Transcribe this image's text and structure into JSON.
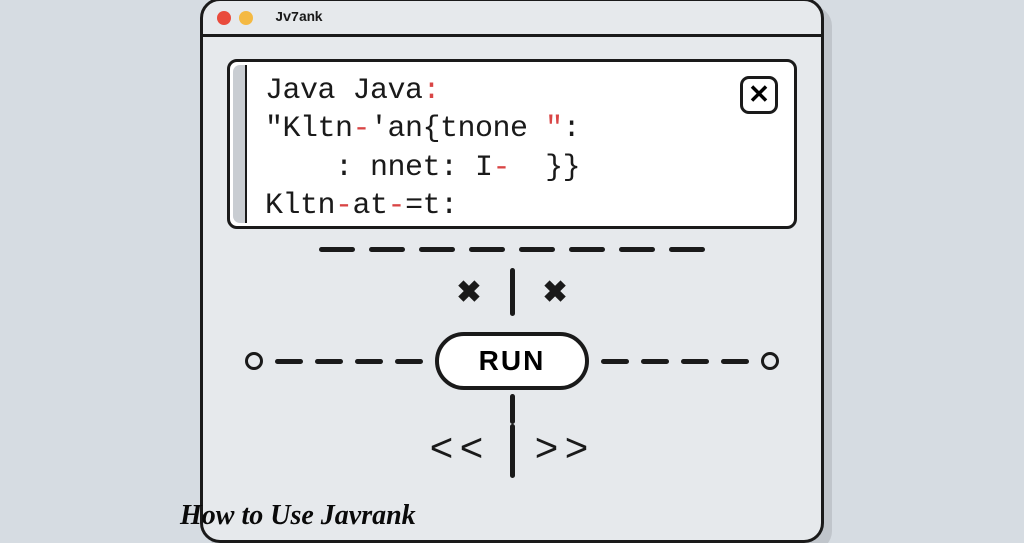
{
  "window": {
    "title": "Jv7ank"
  },
  "code": {
    "line1_a": "Java Java",
    "line1_b": ":",
    "line2_a": "\"Kltn",
    "line2_b": "-",
    "line2_c": "'an{tnone ",
    "line2_d": "\"",
    "line2_e": ":",
    "line3_a": "    : nnet: I",
    "line3_b": "-",
    "line3_c": "  }}",
    "line4_a": "Kltn",
    "line4_b": "-",
    "line4_c": "at",
    "line4_d": "-",
    "line4_e": "=t:"
  },
  "buttons": {
    "run": "RUN",
    "close": "✕"
  },
  "caption": "How to Use Javrank"
}
